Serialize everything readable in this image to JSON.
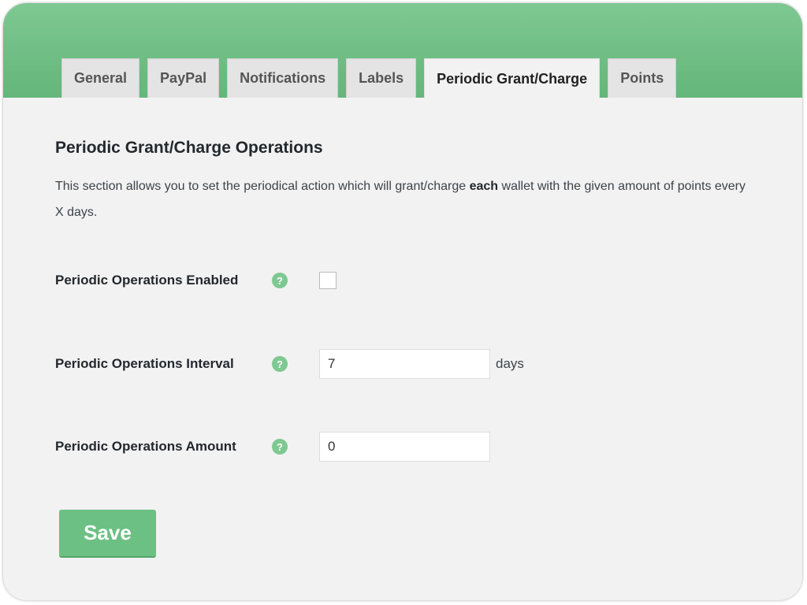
{
  "tabs": [
    {
      "label": "General",
      "active": false
    },
    {
      "label": "PayPal",
      "active": false
    },
    {
      "label": "Notifications",
      "active": false
    },
    {
      "label": "Labels",
      "active": false
    },
    {
      "label": "Periodic Grant/Charge",
      "active": true
    },
    {
      "label": "Points",
      "active": false
    }
  ],
  "section": {
    "title": "Periodic Grant/Charge Operations",
    "desc_before": "This section allows you to set the periodical action which will grant/charge ",
    "desc_bold": "each",
    "desc_after": " wallet with the given amount of points every X days."
  },
  "fields": {
    "enabled": {
      "label": "Periodic Operations Enabled",
      "checked": false
    },
    "interval": {
      "label": "Periodic Operations Interval",
      "value": "7",
      "suffix": "days"
    },
    "amount": {
      "label": "Periodic Operations Amount",
      "value": "0"
    }
  },
  "help_glyph": "?",
  "save_label": "Save",
  "colors": {
    "accent": "#6cc083",
    "header": "#72bf88",
    "background": "#f2f2f2"
  },
  "icons": {
    "help": "question-circle-icon"
  }
}
